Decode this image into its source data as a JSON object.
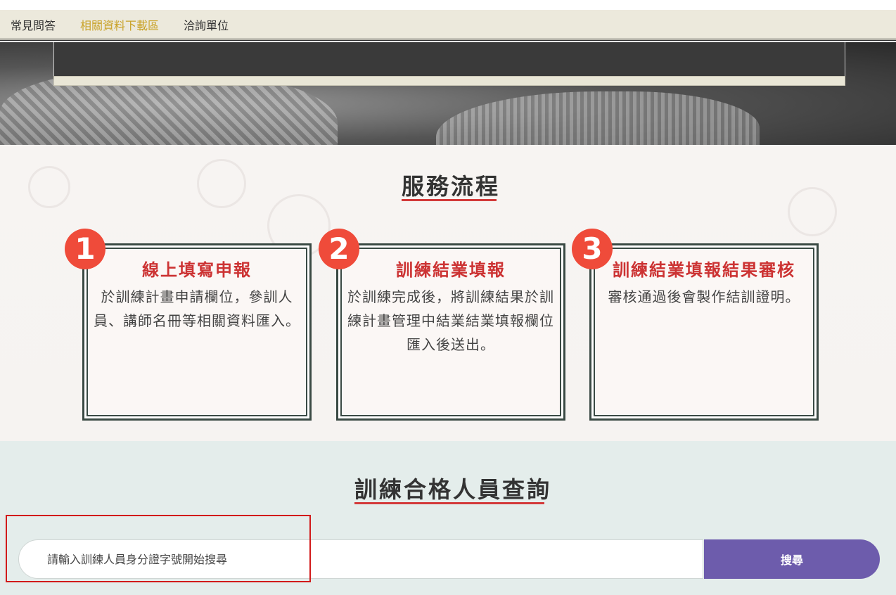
{
  "nav": {
    "items": [
      {
        "label": "常見問答",
        "active": false
      },
      {
        "label": "相關資料下載區",
        "active": true
      },
      {
        "label": "洽詢單位",
        "active": false
      }
    ]
  },
  "process": {
    "title": "服務流程",
    "steps": [
      {
        "number": "1",
        "title": "線上填寫申報",
        "description": "於訓練計畫申請欄位，參訓人員、講師名冊等相關資料匯入。"
      },
      {
        "number": "2",
        "title": "訓練結業填報",
        "description": "於訓練完成後，將訓練結果於訓練計畫管理中結業結業填報欄位匯入後送出。"
      },
      {
        "number": "3",
        "title": "訓練結業填報結果審核",
        "description": "審核通過後會製作結訓證明。"
      }
    ]
  },
  "query": {
    "title": "訓練合格人員查詢",
    "search_placeholder": "請輸入訓練人員身分證字號開始搜尋",
    "search_button": "搜尋"
  },
  "colors": {
    "accent_red": "#d33a3a",
    "badge": "#ef4b3a",
    "button": "#6d5cac",
    "nav_active": "#c9a227"
  }
}
